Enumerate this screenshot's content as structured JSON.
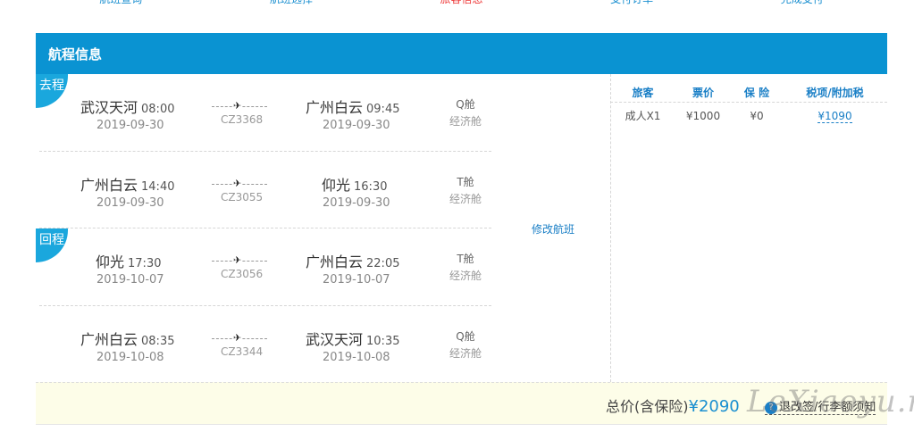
{
  "steps": [
    {
      "label": "航班查询",
      "active": false
    },
    {
      "label": "航班选择",
      "active": false
    },
    {
      "label": "旅客信息",
      "active": true
    },
    {
      "label": "支付订单",
      "active": false
    },
    {
      "label": "完成支付",
      "active": false
    }
  ],
  "panel": {
    "title": "航程信息",
    "modify_label": "修改航班"
  },
  "tags": {
    "outbound": "去程",
    "return": "回程"
  },
  "flights": [
    {
      "dep_city": "武汉天河",
      "dep_time": "08:00",
      "dep_date": "2019-09-30",
      "flight_no": "CZ3368",
      "arr_city": "广州白云",
      "arr_time": "09:45",
      "arr_date": "2019-09-30",
      "cabin": "Q舱",
      "cabin_class": "经济舱"
    },
    {
      "dep_city": "广州白云",
      "dep_time": "14:40",
      "dep_date": "2019-09-30",
      "flight_no": "CZ3055",
      "arr_city": "仰光",
      "arr_time": "16:30",
      "arr_date": "2019-09-30",
      "cabin": "T舱",
      "cabin_class": "经济舱"
    },
    {
      "dep_city": "仰光",
      "dep_time": "17:30",
      "dep_date": "2019-10-07",
      "flight_no": "CZ3056",
      "arr_city": "广州白云",
      "arr_time": "22:05",
      "arr_date": "2019-10-07",
      "cabin": "T舱",
      "cabin_class": "经济舱"
    },
    {
      "dep_city": "广州白云",
      "dep_time": "08:35",
      "dep_date": "2019-10-08",
      "flight_no": "CZ3344",
      "arr_city": "武汉天河",
      "arr_time": "10:35",
      "arr_date": "2019-10-08",
      "cabin": "Q舱",
      "cabin_class": "经济舱"
    }
  ],
  "price_table": {
    "headers": [
      "旅客",
      "票价",
      "保 险",
      "税项/附加税"
    ],
    "rows": [
      {
        "passenger": "成人X1",
        "fare": "¥1000",
        "insurance": "¥0",
        "tax": "¥1090"
      }
    ]
  },
  "footer": {
    "total_label": "总价(含保险)",
    "total_amount": "¥2090",
    "notice_icon": "question-icon",
    "notice_label": "退改签/行李额须知"
  },
  "watermark": "LeXiaoyu.net",
  "colors": {
    "header_bg": "#0a93d2",
    "accent": "#1a8fd0",
    "tag_bg": "#1aa7dd",
    "footer_bg": "#fdfde8",
    "active_step": "#ee3333"
  }
}
